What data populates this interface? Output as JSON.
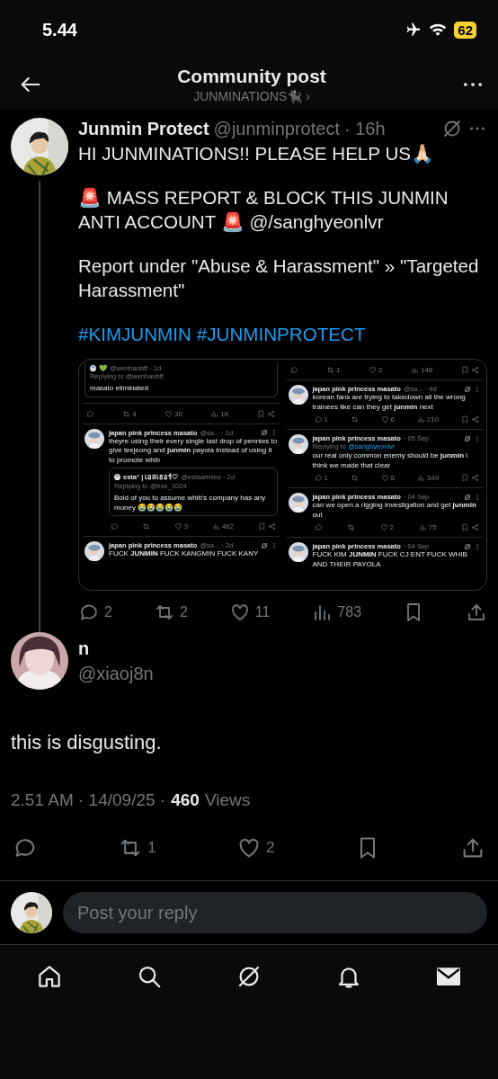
{
  "status_bar": {
    "time": "5.44",
    "battery": "62"
  },
  "header": {
    "title": "Community post",
    "community": "JUNMINATIONS🐈‍⬛",
    "chevron": "›"
  },
  "post": {
    "name": "Junmin Protect",
    "handle": "@junminprotect",
    "time": "· 16h",
    "paragraphs": [
      "HI JUNMINATIONS!! PLEASE HELP US🙏🏻",
      "🚨 MASS REPORT & BLOCK THIS JUNMIN ANTI ACCOUNT 🚨 @/sanghyeonlvr",
      "Report under \"Abuse & Harassment\" » \"Targeted Harassment\""
    ],
    "hashtags": [
      "#KIMJUNMIN",
      "#JUNMINPROTECT"
    ],
    "embed": {
      "columns": [
        [
          {
            "kind": "quote",
            "name": "💚",
            "handle": "@wenhanbff · 1d",
            "replying": "Replying to",
            "reply_handle": "@wenhanbff",
            "text": "masato eliminated"
          },
          {
            "kind": "stats",
            "retweet": "4",
            "like": "30",
            "views": "1K"
          },
          {
            "kind": "tweet",
            "name": "japan pink princess masato",
            "meta": "@sa... · 1d",
            "text": "theyre using their every single last drop of pennies to give leejeong and **junmin** payola instead of using it to promote whib",
            "quote": {
              "name": "esta⁷ | เอสเธอร์♡",
              "handle": "@estaarmiee · 2d",
              "replying": "Replying to",
              "reply_handle": "@bee_1024",
              "text": "Bold of you to assume whib's company has any money 😭😭😭😭😭"
            },
            "stats": {
              "like": "3",
              "views": "462"
            }
          },
          {
            "kind": "tweet",
            "name": "japan pink princess masato",
            "meta": "@sa... · 2d",
            "text": "FUCK **JUNMIN** FUCK KANGMIN FUCK KANY"
          }
        ],
        [
          {
            "kind": "stats",
            "retweet": "1",
            "like": "2",
            "views": "146"
          },
          {
            "kind": "tweet",
            "name": "japan pink princess masato",
            "meta": "@sa... · 4d",
            "text": "korean fans are trying to takedown all the wrong trainees like can they get **junmin** next",
            "stats": {
              "reply": "1",
              "like": "6",
              "views": "210"
            }
          },
          {
            "kind": "tweet",
            "name": "japan pink princess masato",
            "meta": "· 05 Sep",
            "replying": "Replying to",
            "reply_handle": "@sanghyeonlvr",
            "text": "our real only common enemy should be **junmin** i think we made that clear",
            "stats": {
              "reply": "1",
              "like": "5",
              "views": "349"
            }
          },
          {
            "kind": "tweet",
            "name": "japan pink princess masato",
            "meta": "· 04 Sep",
            "text": "can we open a rigging investigation and get **junmin** out",
            "stats": {
              "like": "2",
              "views": "75"
            }
          },
          {
            "kind": "tweet",
            "name": "japan pink princess masato",
            "meta": "· 04 Sep",
            "text": "FUCK KIM **JUNMIN** FUCK CJ ENT FUCK WHIB AND THEIR PAYOLA"
          }
        ]
      ]
    },
    "stats": {
      "reply": "2",
      "retweet": "2",
      "like": "11",
      "views": "783"
    }
  },
  "reply": {
    "name": "n",
    "handle": "@xiaoj8n",
    "text": "this is disgusting.",
    "time": "2.51 AM · 14/09/25 ·",
    "views_count": "460",
    "views_label": "Views",
    "stats": {
      "retweet": "1",
      "like": "2"
    }
  },
  "composer": {
    "placeholder": "Post your reply"
  }
}
